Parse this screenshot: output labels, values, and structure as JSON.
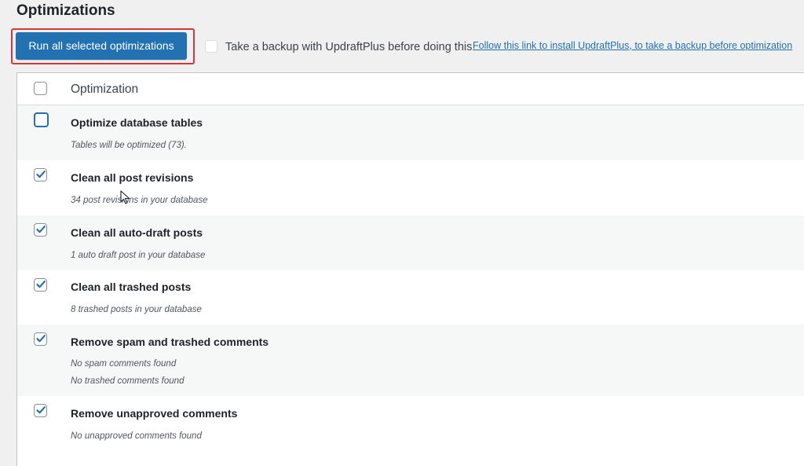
{
  "page": {
    "title": "Optimizations"
  },
  "actions": {
    "run_label": "Run all selected optimizations",
    "backup_label": "Take a backup with UpdraftPlus before doing this",
    "backup_link": "Follow this link to install UpdraftPlus, to take a backup before optimization"
  },
  "table": {
    "header": "Optimization",
    "rows": [
      {
        "title": "Optimize database tables",
        "desc": [
          "Tables will be optimized (73)."
        ],
        "checked": false
      },
      {
        "title": "Clean all post revisions",
        "desc": [
          "34 post revisions in your database"
        ],
        "checked": true
      },
      {
        "title": "Clean all auto-draft posts",
        "desc": [
          "1 auto draft post in your database"
        ],
        "checked": true
      },
      {
        "title": "Clean all trashed posts",
        "desc": [
          "8 trashed posts in your database"
        ],
        "checked": true
      },
      {
        "title": "Remove spam and trashed comments",
        "desc": [
          "No spam comments found",
          "No trashed comments found"
        ],
        "checked": true
      },
      {
        "title": "Remove unapproved comments",
        "desc": [
          "No unapproved comments found"
        ],
        "checked": true
      }
    ]
  },
  "colors": {
    "primary": "#2271b1",
    "highlight": "#d63638"
  }
}
